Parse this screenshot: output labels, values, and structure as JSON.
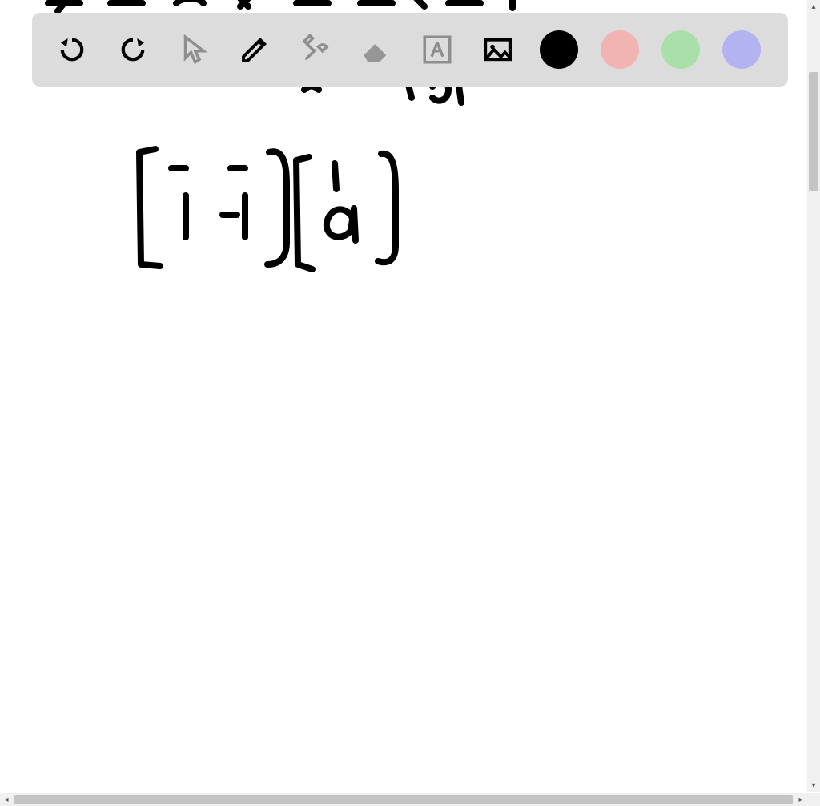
{
  "toolbar": {
    "tools": {
      "undo": "undo",
      "redo": "redo",
      "pointer": "pointer",
      "pen": "pen",
      "tools": "tools",
      "eraser": "eraser",
      "text": "text",
      "image": "image"
    },
    "colors": {
      "black": "#000000",
      "pink": "#f2b3b3",
      "green": "#a9e0a9",
      "purple": "#b3b3f2"
    },
    "selected_color": "black",
    "selected_tool": "pen",
    "disabled_tools": [
      "pointer",
      "tools",
      "eraser",
      "text"
    ]
  },
  "canvas": {
    "handwriting_description": "[-1 -1][a]",
    "scroll": {
      "vertical_thumb_top_pct": 9,
      "vertical_thumb_height_pct": 15,
      "horizontal_thumb_left_pct": 2,
      "horizontal_thumb_width_pct": 97
    }
  }
}
